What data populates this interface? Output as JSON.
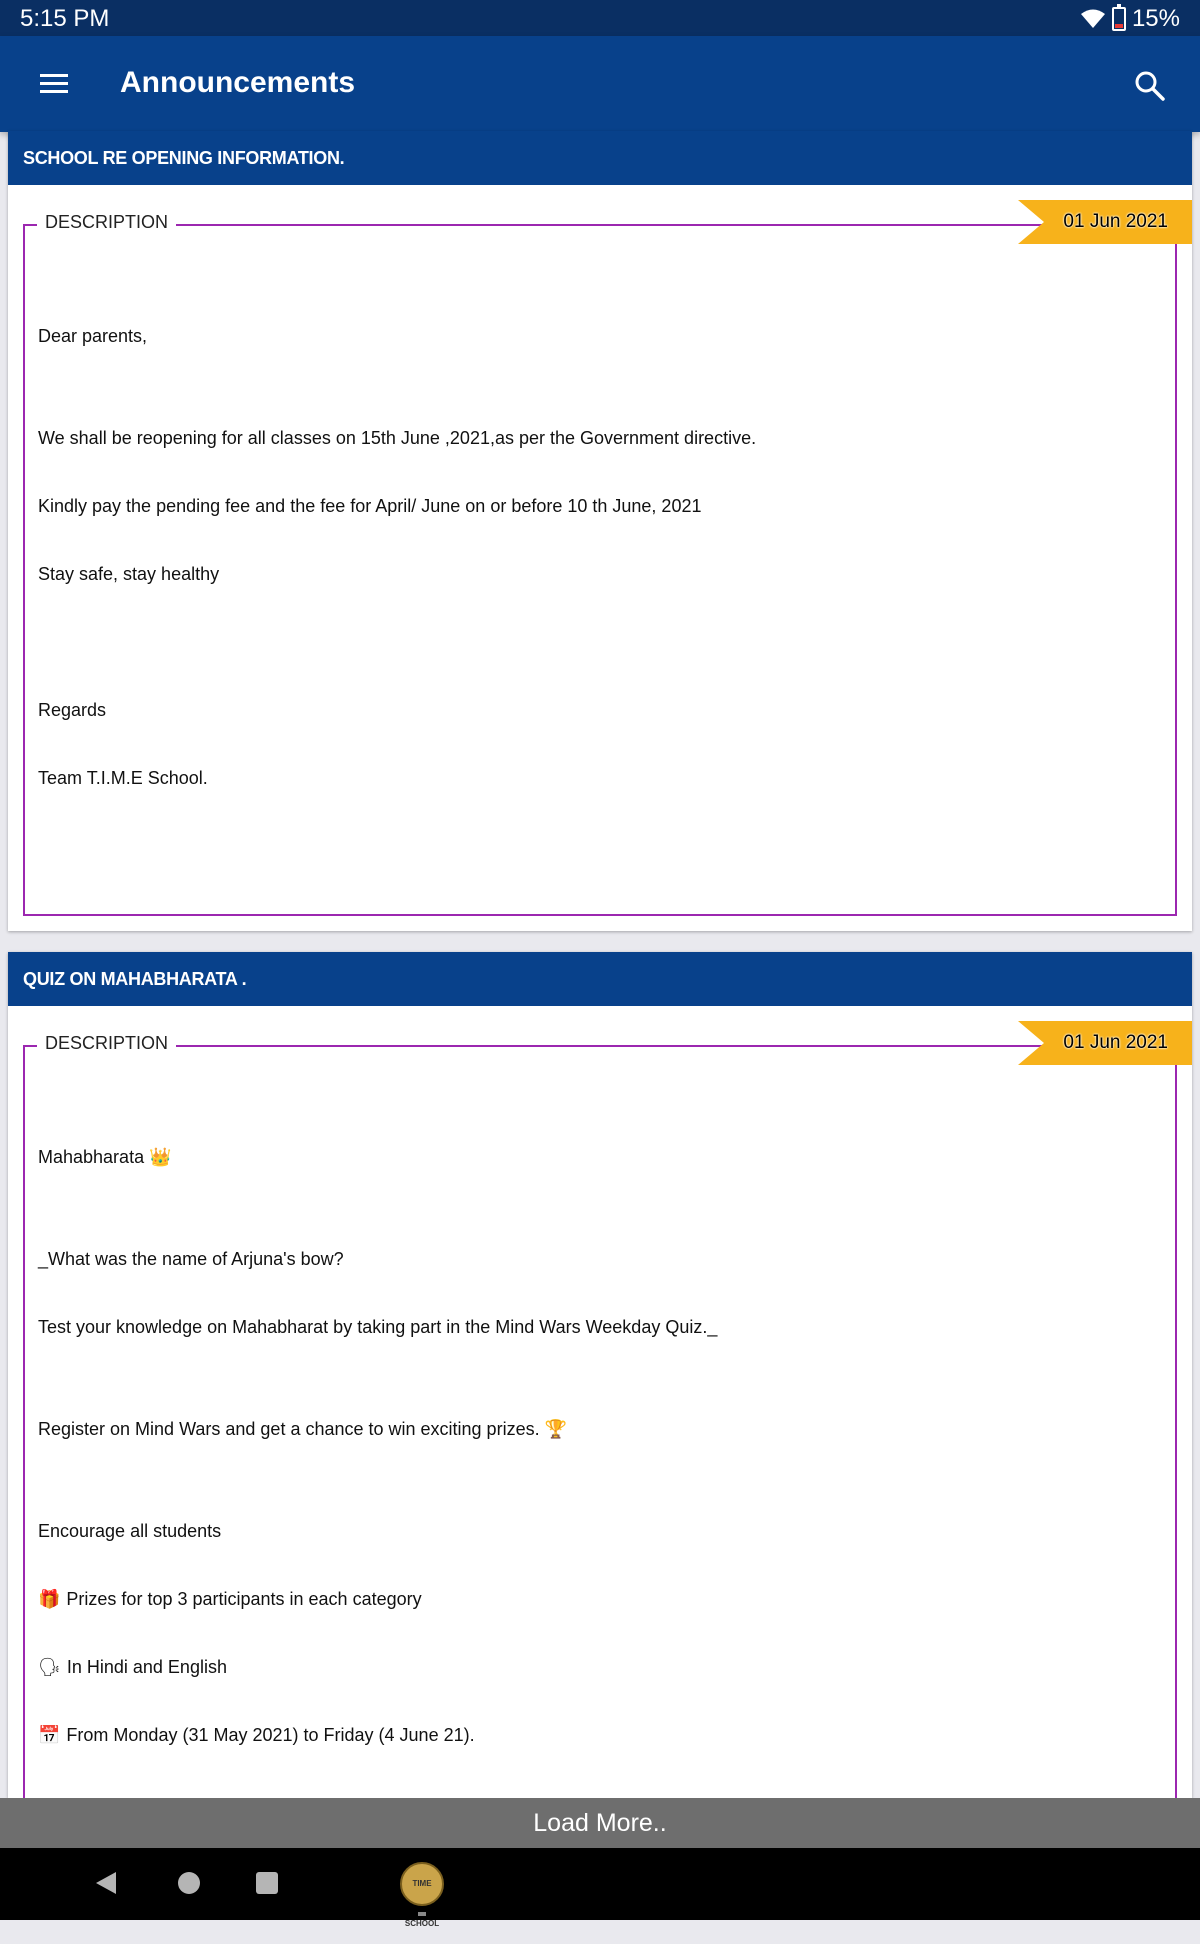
{
  "status_bar": {
    "time": "5:15 PM",
    "battery": "15%"
  },
  "app_bar": {
    "title": "Announcements"
  },
  "announcements": [
    {
      "title": "SCHOOL RE OPENING INFORMATION.",
      "date": "01 Jun 2021",
      "legend": "DESCRIPTION",
      "lines": [
        "Dear parents,",
        "We shall be reopening for all classes on 15th June ,2021,as per the Government directive.",
        "Kindly pay the pending fee and the fee for April/ June on or before 10 th June, 2021",
        "Stay safe, stay healthy",
        "Regards",
        "Team T.I.M.E  School."
      ]
    },
    {
      "title": "QUIZ ON MAHABHARATA .",
      "date": "01 Jun 2021",
      "legend": "DESCRIPTION",
      "lines": [
        "Mahabharata",
        "_What was the name of Arjuna's bow?",
        "Test your knowledge on Mahabharat by taking part in the Mind Wars Weekday Quiz._",
        "Register on Mind Wars and get a chance to win exciting prizes.",
        "Encourage all students",
        "Prizes for top 3 participants in each category",
        "In Hindi and English",
        "From Monday (31 May 2021) to Friday (4 June 21)."
      ],
      "emojis": {
        "crown": "👑",
        "trophy": "🏆",
        "gift": "🎁",
        "speaking": "🗣",
        "calendar": "📅"
      }
    }
  ],
  "load_more": "Load More..",
  "nav_app_label": "TIME SCHOOL"
}
